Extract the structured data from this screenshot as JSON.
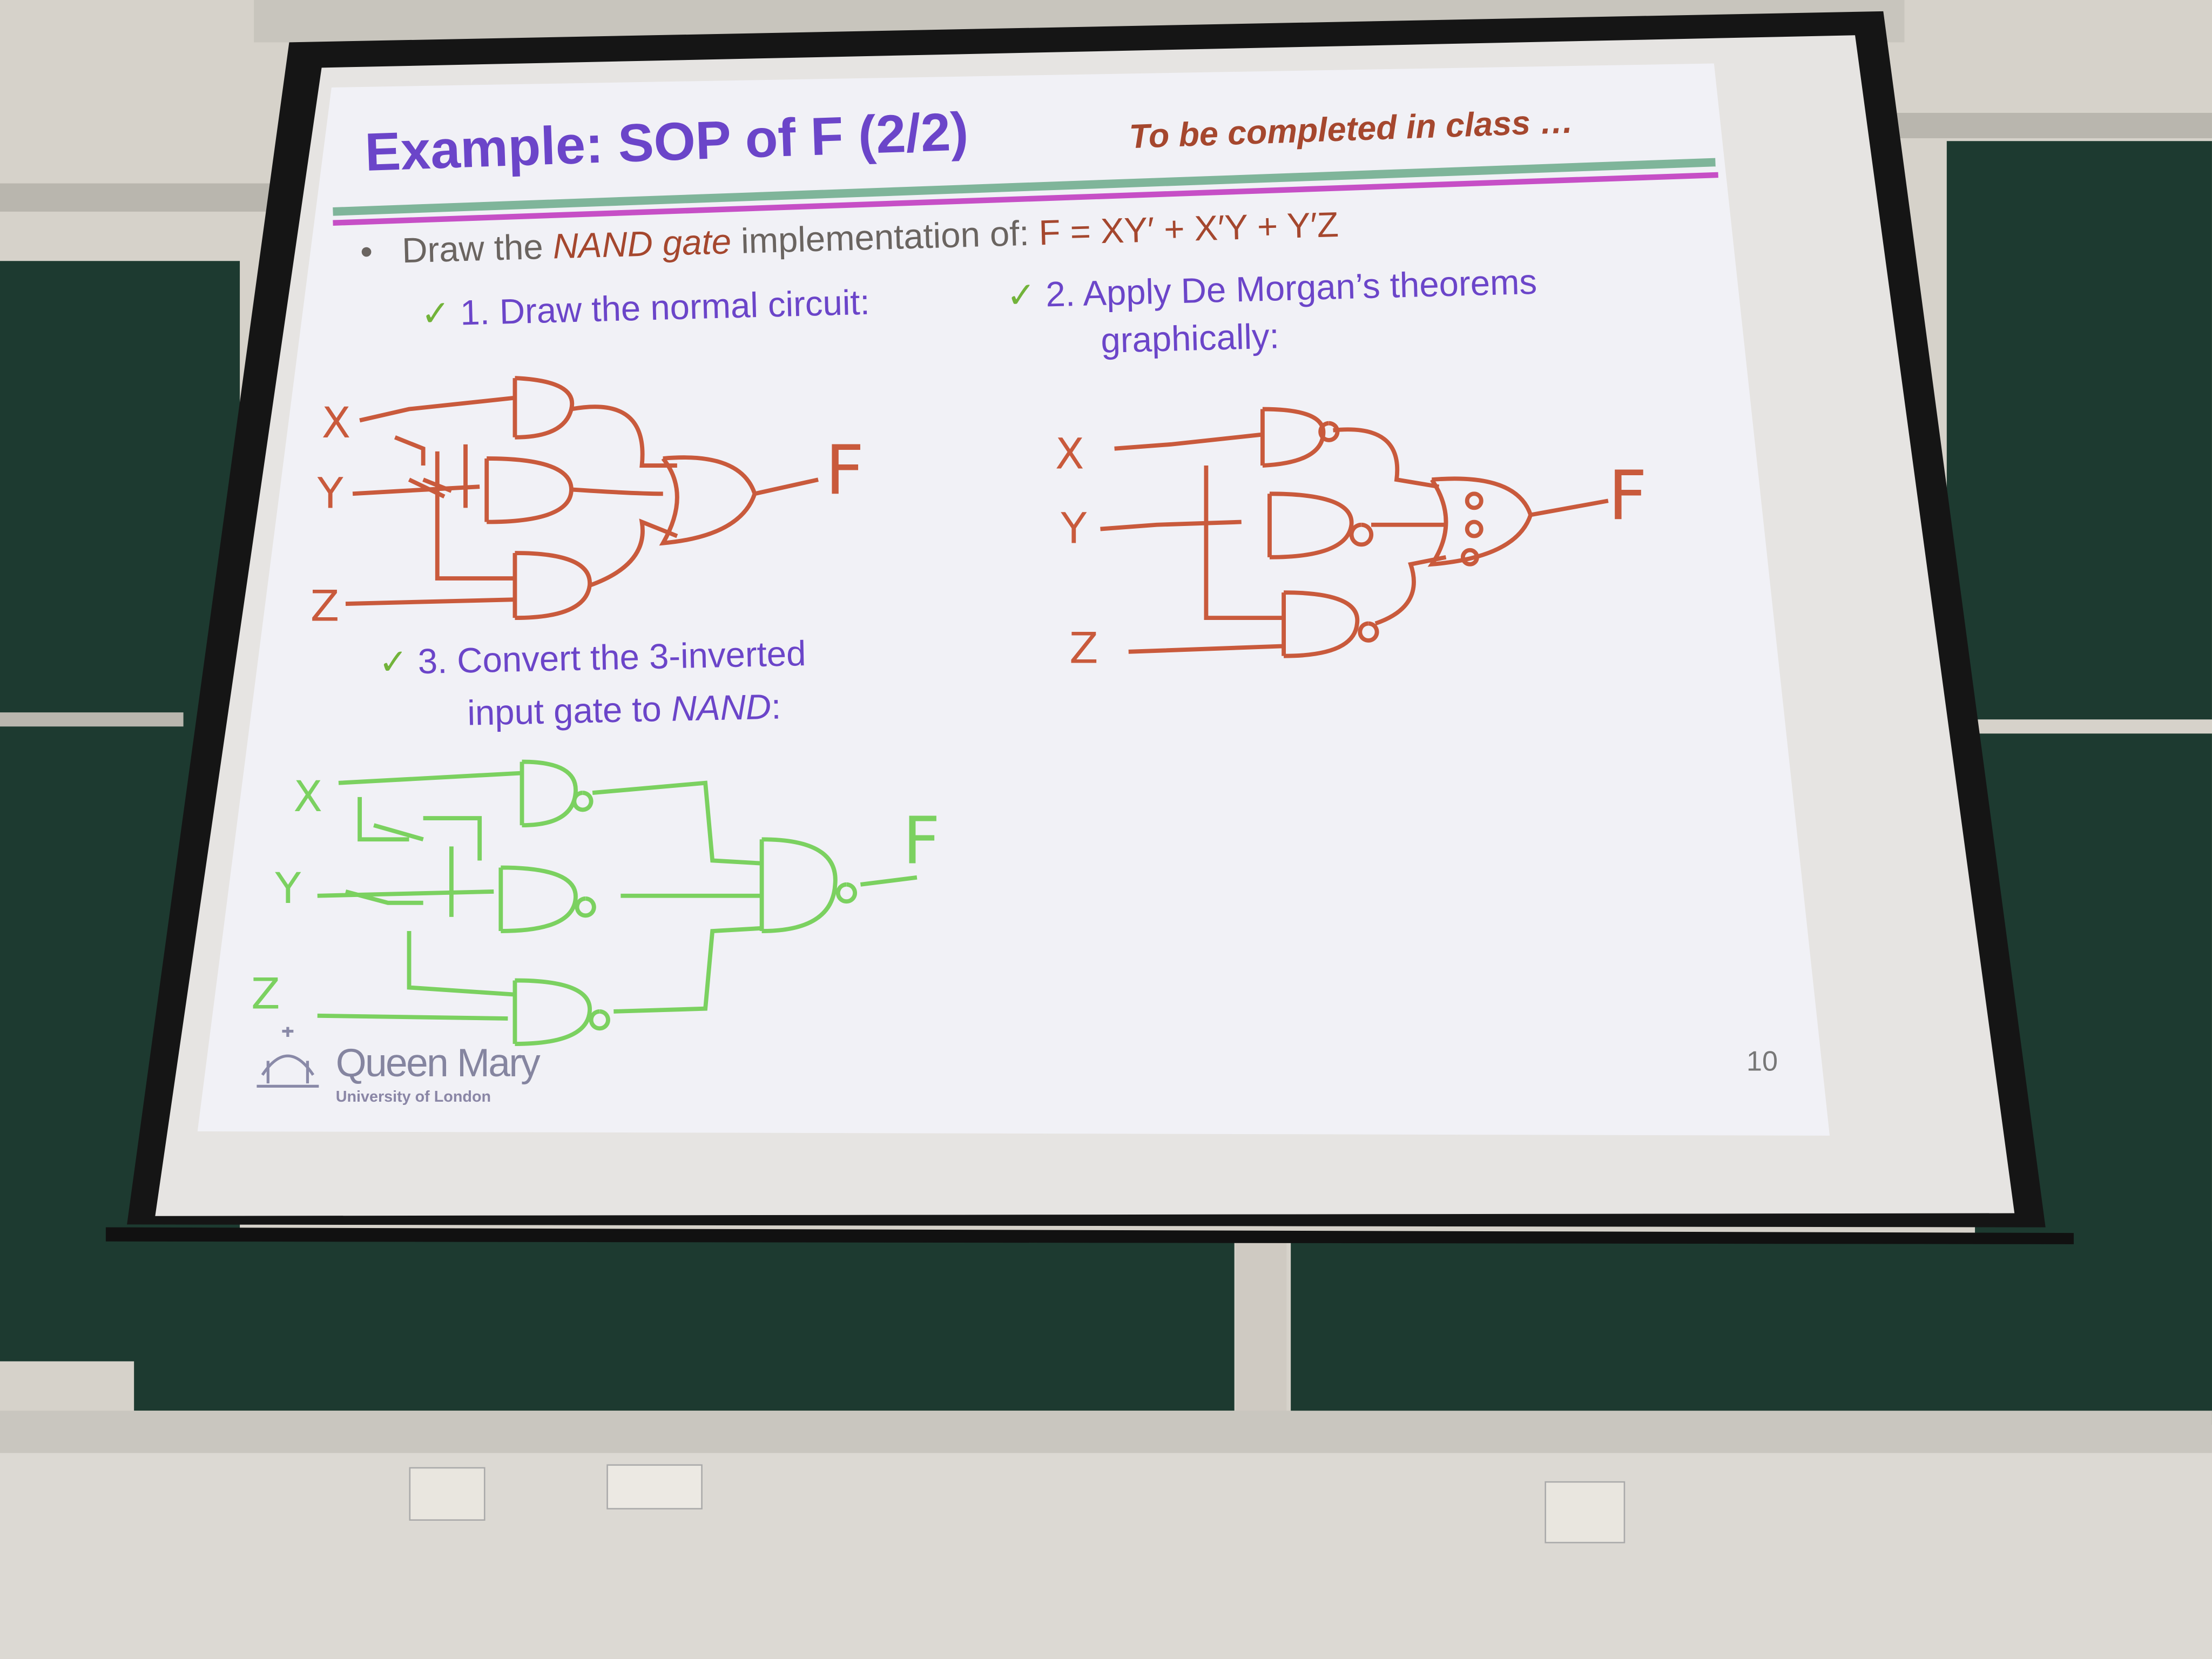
{
  "slide": {
    "title": "Example: SOP of F (2/2)",
    "subtitle": "To be completed in class …",
    "bullet": {
      "prefix": "Draw the",
      "emphasis": "NAND gate",
      "middle": "implementation of:",
      "equation": "F = XY′ + X′Y + Y′Z"
    },
    "steps": [
      {
        "check": "✓",
        "text": "1. Draw the normal circuit:"
      },
      {
        "check": "✓",
        "text": "2. Apply De Morgan’s theorems",
        "text2": "graphically:"
      },
      {
        "check": "✓",
        "text": "3. Convert the 3-inverted",
        "text2a": "input gate to",
        "text2b": "NAND",
        "text2c": ":"
      }
    ],
    "logo": {
      "name": "Queen Mary",
      "sub": "University of London"
    },
    "page_number": "10"
  },
  "handwriting": {
    "circuit1": {
      "inputs": [
        "X",
        "Y",
        "Z"
      ],
      "output": "F",
      "color": "#c95a3c"
    },
    "circuit2": {
      "inputs": [
        "X",
        "Y",
        "Z"
      ],
      "output": "F",
      "color": "#c95a3c"
    },
    "circuit3": {
      "inputs": [
        "X",
        "Y",
        "Z"
      ],
      "output": "F",
      "color": "#7bd160"
    }
  },
  "colors": {
    "title": "#6b45c9",
    "accent": "#a5472e",
    "board": "#1d3a30"
  }
}
